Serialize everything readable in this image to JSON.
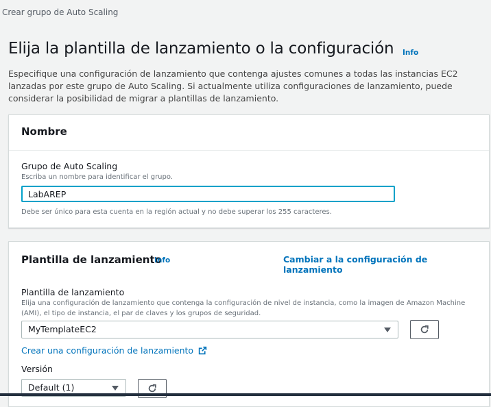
{
  "breadcrumb": "Crear grupo de Auto Scaling",
  "page": {
    "title": "Elija la plantilla de lanzamiento o la configuración",
    "info": "Info",
    "description": "Especifique una configuración de lanzamiento que contenga ajustes comunes a todas las instancias EC2 lanzadas por este grupo de Auto Scaling. Si actualmente utiliza configuraciones de lanzamiento, puede considerar la posibilidad de migrar a plantillas de lanzamiento."
  },
  "name_panel": {
    "title": "Nombre",
    "field_label": "Grupo de Auto Scaling",
    "field_desc": "Escriba un nombre para identificar el grupo.",
    "value": "LabAREP",
    "constraint": "Debe ser único para esta cuenta en la región actual y no debe superar los 255 caracteres."
  },
  "template_panel": {
    "title": "Plantilla de lanzamiento",
    "info": "Info",
    "switch_link": "Cambiar a la configuración de lanzamiento",
    "field_label": "Plantilla de lanzamiento",
    "field_desc": "Elija una configuración de lanzamiento que contenga la configuración de nivel de instancia, como la imagen de Amazon Machine (AMI), el tipo de instancia, el par de claves y los grupos de seguridad.",
    "selected": "MyTemplateEC2",
    "create_link": "Crear una configuración de lanzamiento",
    "version_label": "Versión",
    "version_selected": "Default (1)"
  },
  "icons": {
    "refresh": "refresh-icon",
    "external": "external-link-icon",
    "caret": "caret-down-icon"
  },
  "colors": {
    "link": "#0073bb",
    "focus": "#00a1c9",
    "background": "#f2f3f3"
  }
}
